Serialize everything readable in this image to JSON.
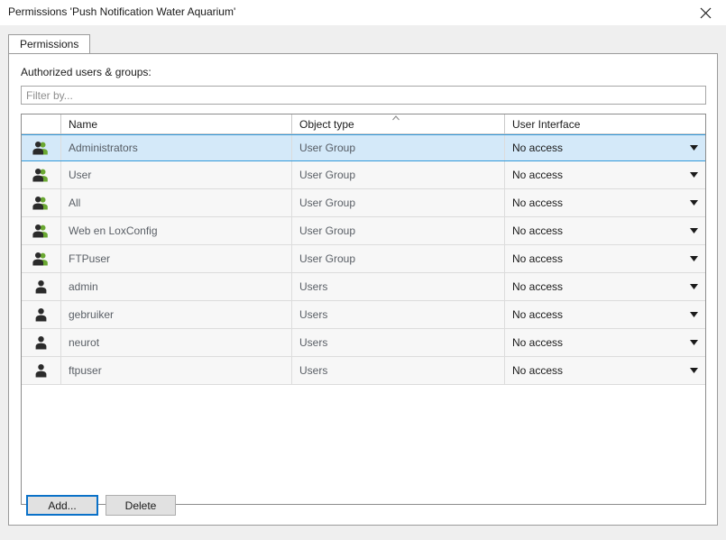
{
  "window": {
    "title": "Permissions 'Push Notification Water Aquarium'",
    "close_icon": "close-icon"
  },
  "tabs": [
    {
      "label": "Permissions",
      "active": true
    }
  ],
  "panel": {
    "label": "Authorized users & groups:",
    "filter": {
      "value": "",
      "placeholder": "Filter by..."
    }
  },
  "table": {
    "columns": [
      {
        "key": "icon",
        "label": ""
      },
      {
        "key": "name",
        "label": "Name"
      },
      {
        "key": "type",
        "label": "Object type"
      },
      {
        "key": "ui",
        "label": "User Interface"
      }
    ],
    "sort": {
      "column": "Object type",
      "direction": "ascending",
      "icon": "caret-up-icon"
    },
    "rows": [
      {
        "icon": "user-group-icon",
        "name": "Administrators",
        "type": "User Group",
        "ui": "No access",
        "selected": true
      },
      {
        "icon": "user-group-icon",
        "name": "User",
        "type": "User Group",
        "ui": "No access",
        "selected": false
      },
      {
        "icon": "user-group-icon",
        "name": "All",
        "type": "User Group",
        "ui": "No access",
        "selected": false
      },
      {
        "icon": "user-group-icon",
        "name": "Web en LoxConfig",
        "type": "User Group",
        "ui": "No access",
        "selected": false
      },
      {
        "icon": "user-group-icon",
        "name": "FTPuser",
        "type": "User Group",
        "ui": "No access",
        "selected": false
      },
      {
        "icon": "user-single-icon",
        "name": "admin",
        "type": "Users",
        "ui": "No access",
        "selected": false
      },
      {
        "icon": "user-single-icon",
        "name": "gebruiker",
        "type": "Users",
        "ui": "No access",
        "selected": false
      },
      {
        "icon": "user-single-icon",
        "name": "neurot",
        "type": "Users",
        "ui": "No access",
        "selected": false
      },
      {
        "icon": "user-single-icon",
        "name": "ftpuser",
        "type": "Users",
        "ui": "No access",
        "selected": false
      }
    ]
  },
  "footer": {
    "add_label": "Add...",
    "delete_label": "Delete"
  },
  "colors": {
    "selection": "#d4e9f9",
    "selection_border": "#3399d9",
    "focus_border": "#0a71c8",
    "window_bg": "#efefef"
  }
}
